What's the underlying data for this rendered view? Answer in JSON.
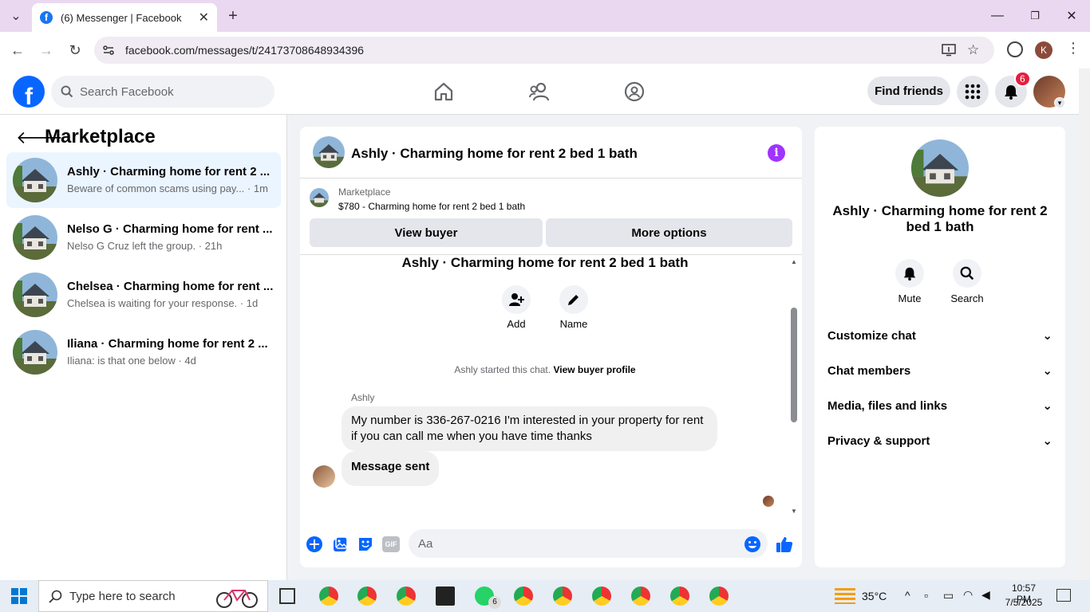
{
  "browser": {
    "tab_title": "(6) Messenger | Facebook",
    "url": "facebook.com/messages/t/24173708648934396"
  },
  "header": {
    "search_placeholder": "Search Facebook",
    "find_friends": "Find friends",
    "notification_count": "6"
  },
  "sidebar": {
    "title": "Marketplace",
    "conversations": [
      {
        "name": "Ashly · Charming home for rent 2 ...",
        "preview": "Beware of common scams using pay... · 1m"
      },
      {
        "name": "Nelso G · Charming home for rent ...",
        "preview": "Nelso G Cruz left the group. · 21h"
      },
      {
        "name": "Chelsea · Charming home for rent ...",
        "preview": "Chelsea is waiting for your response. · 1d"
      },
      {
        "name": "Iliana · Charming home for rent 2 ...",
        "preview": "Iliana: is that one below · 4d"
      }
    ]
  },
  "chat": {
    "title": "Ashly · Charming home for rent 2 bed 1 bath",
    "marketplace_label": "Marketplace",
    "listing": "$780 - Charming home for rent 2 bed 1 bath",
    "view_buyer": "View buyer",
    "more_options": "More options",
    "center_title": "Ashly · Charming home for rent 2 bed 1 bath",
    "add_label": "Add",
    "name_label": "Name",
    "system_msg": "Ashly started this chat.",
    "view_buyer_profile": "View buyer profile",
    "sender": "Ashly",
    "message_1": "My number is 336-267-0216 I'm interested in your property for rent if you can call me when you have time thanks",
    "message_2": "Message sent",
    "composer_placeholder": "Aa",
    "gif_label": "GIF"
  },
  "details": {
    "title": "Ashly · Charming home for rent 2 bed 1 bath",
    "mute": "Mute",
    "search": "Search",
    "sections": [
      "Customize chat",
      "Chat members",
      "Media, files and links",
      "Privacy & support"
    ]
  },
  "taskbar": {
    "search_placeholder": "Type here to search",
    "temperature": "35°C",
    "time": "10:57 PM",
    "date": "7/5/2025",
    "whatsapp_badge": "6"
  },
  "colors": {
    "facebook_blue": "#0866ff",
    "messenger_purple": "#a033ff",
    "notification_red": "#e41e3f"
  }
}
